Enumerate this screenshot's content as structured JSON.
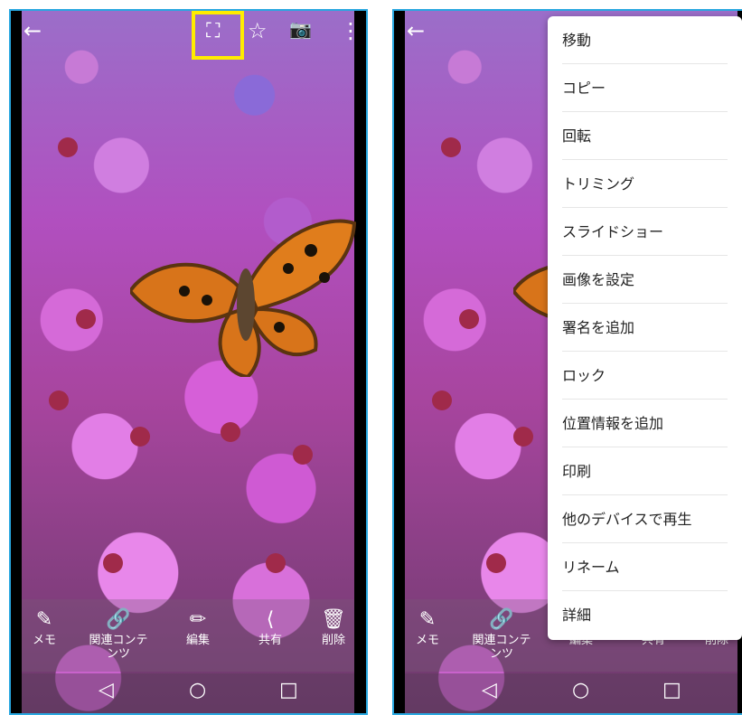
{
  "left_screen": {
    "top_icons": {
      "back": "←",
      "scan": "⛶",
      "favorite": "☆",
      "camera": "📷",
      "more": "⋮"
    },
    "actions": [
      {
        "icon": "✎",
        "label": "メモ"
      },
      {
        "icon": "🔗",
        "label": "関連コンテンツ"
      },
      {
        "icon": "✏",
        "label": "編集"
      },
      {
        "icon": "⟨",
        "label": "共有"
      },
      {
        "icon": "🗑",
        "label": "削除"
      }
    ],
    "nav": {
      "back": "◁",
      "home": "○",
      "recent": "□"
    }
  },
  "right_screen": {
    "top_icons": {
      "back": "←"
    },
    "menu_items": [
      "移動",
      "コピー",
      "回転",
      "トリミング",
      "スライドショー",
      "画像を設定",
      "署名を追加",
      "ロック",
      "位置情報を追加",
      "印刷",
      "他のデバイスで再生",
      "リネーム",
      "詳細"
    ],
    "actions": [
      {
        "icon": "✎",
        "label": "メモ"
      },
      {
        "icon": "🔗",
        "label": "関連コンテンツ"
      },
      {
        "icon": "✏",
        "label": "編集"
      },
      {
        "icon": "⟨",
        "label": "共有"
      },
      {
        "icon": "🗑",
        "label": "削除"
      }
    ],
    "nav": {
      "back": "◁",
      "home": "○",
      "recent": "□"
    }
  },
  "colors": {
    "highlight": "#ffec00",
    "frame": "#29a8e0"
  }
}
